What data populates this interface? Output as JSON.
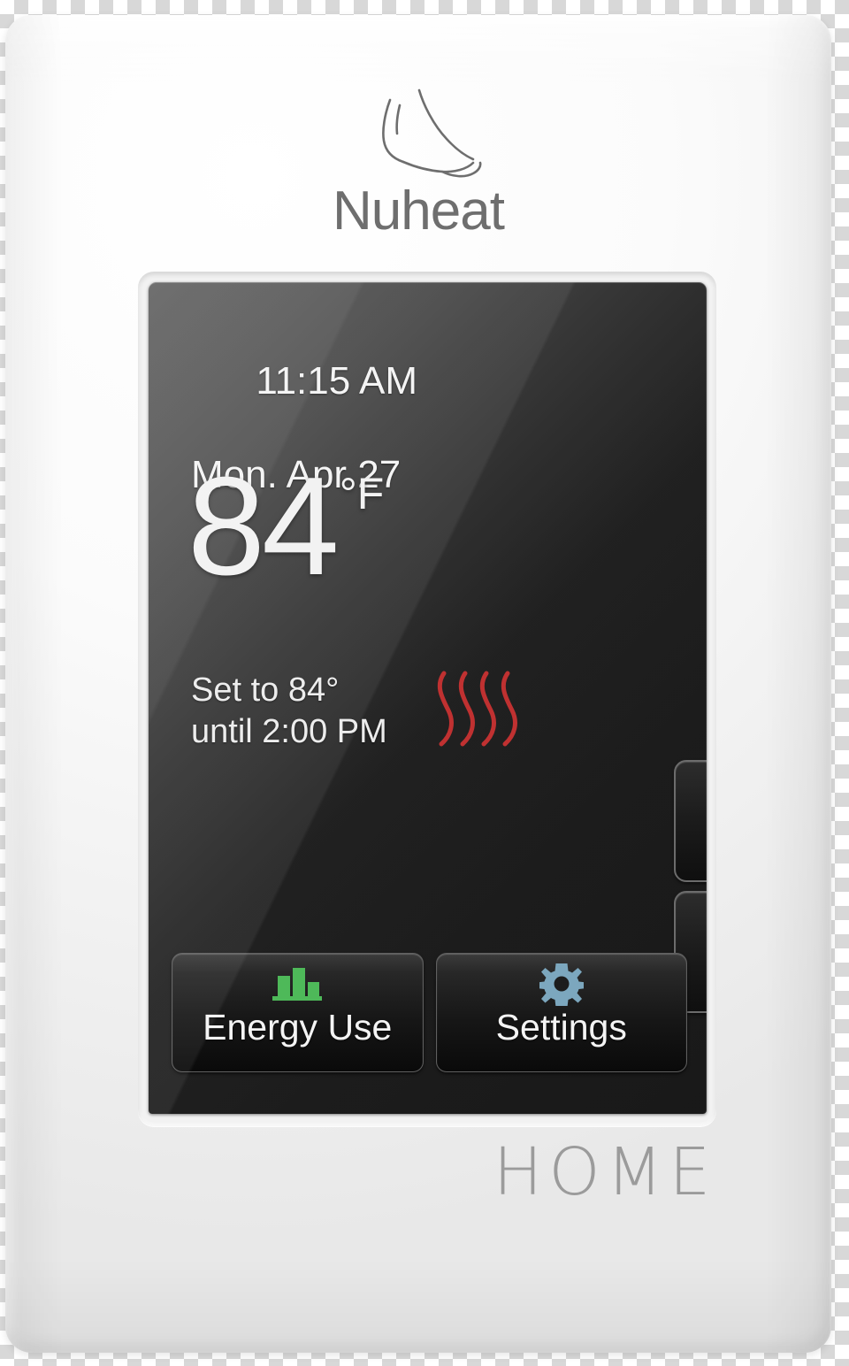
{
  "device": {
    "brand": "Nuheat",
    "model_name": "HOME",
    "brand_icon": "foot-icon"
  },
  "screen": {
    "clock": {
      "time": "11:15 AM",
      "date": "Mon. Apr 27"
    },
    "temperature": {
      "value": "84",
      "unit": "°F"
    },
    "setpoint": {
      "line1": "Set to 84°",
      "line2": "until 2:00 PM"
    },
    "heating_indicator": {
      "icon": "heat-waves-icon",
      "color": "#c0392b",
      "wave_count": 4,
      "active": true
    },
    "stepper": {
      "up_icon": "triangle-up-icon",
      "down_icon": "triangle-down-icon"
    },
    "nav_buttons": [
      {
        "label": "Energy Use",
        "icon": "bar-chart-icon",
        "icon_color": "#4cb857"
      },
      {
        "label": "Settings",
        "icon": "gear-icon",
        "icon_color": "#7aa6bd"
      }
    ]
  },
  "colors": {
    "faceplate": "#f4f4f4",
    "screen_dark": "#161616",
    "screen_light": "#5c5c5c",
    "text_primary": "#f2f2f2",
    "logo_gray": "#6e6e6e",
    "home_gray": "#8e8e8e"
  }
}
